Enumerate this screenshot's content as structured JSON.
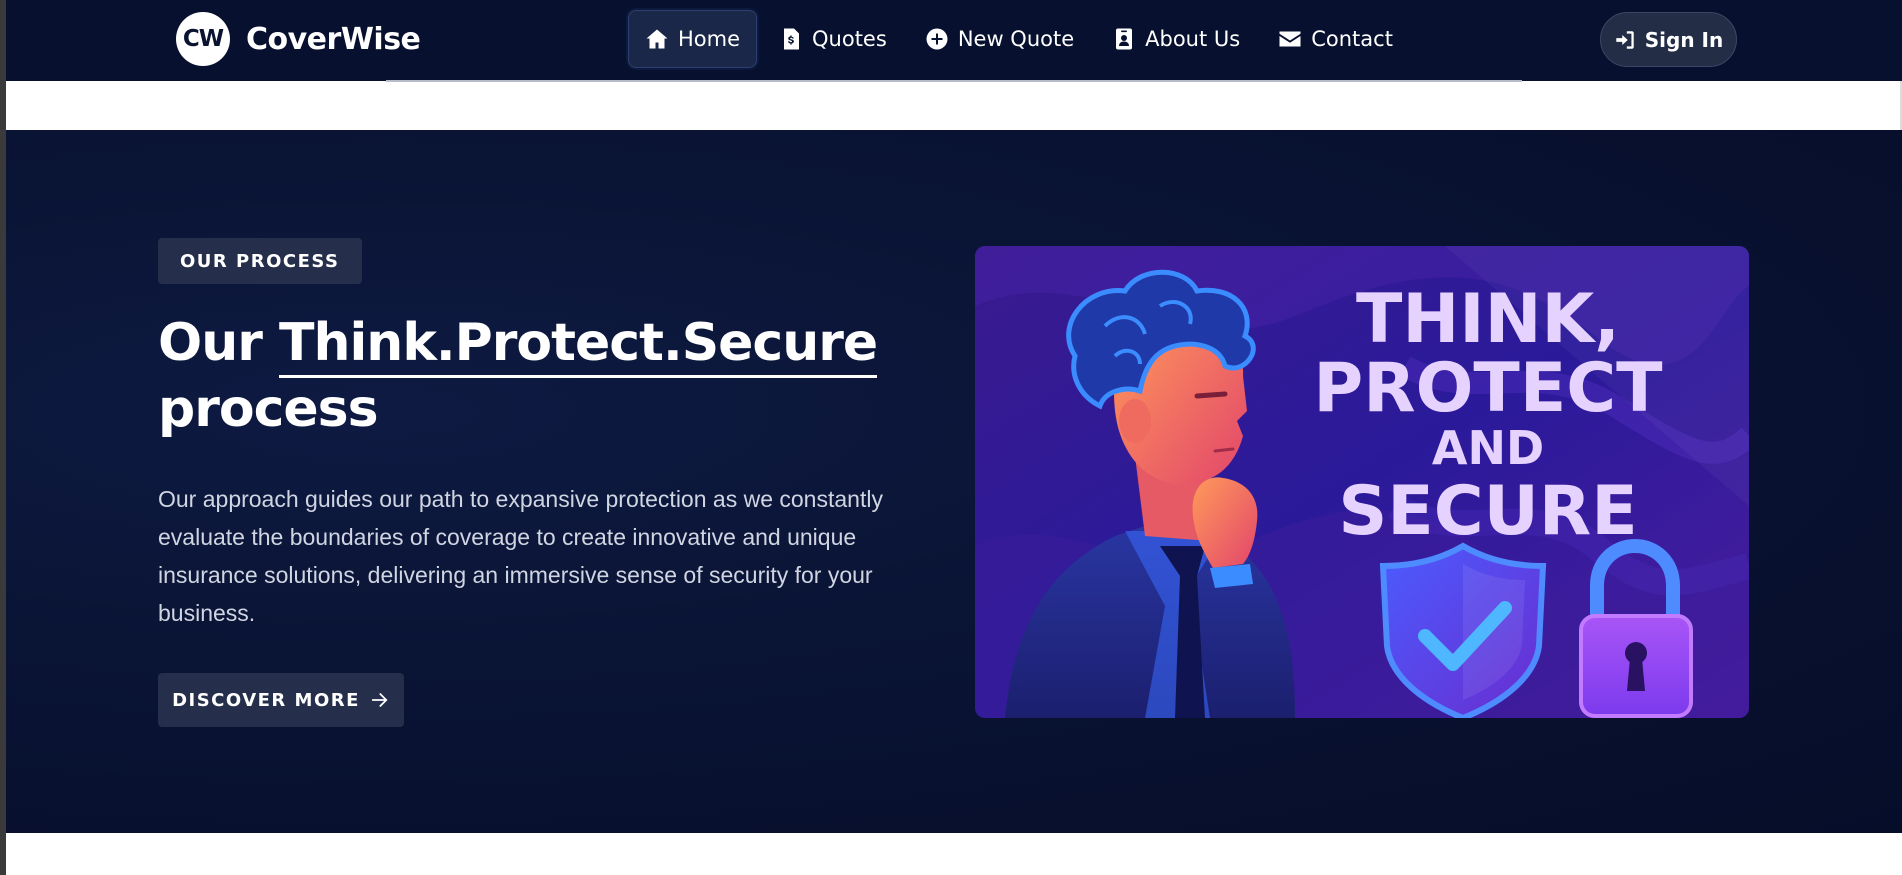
{
  "brand": {
    "logo_text": "CW",
    "name": "CoverWise"
  },
  "nav": {
    "items": [
      {
        "label": "Home",
        "icon": "home-icon",
        "active": true
      },
      {
        "label": "Quotes",
        "icon": "file-invoice-dollar-icon",
        "active": false
      },
      {
        "label": "New Quote",
        "icon": "plus-circle-icon",
        "active": false
      },
      {
        "label": "About Us",
        "icon": "id-badge-icon",
        "active": false
      },
      {
        "label": "Contact",
        "icon": "envelope-icon",
        "active": false
      }
    ],
    "signin_label": "Sign In"
  },
  "hero": {
    "eyebrow": "OUR PROCESS",
    "headline_prefix": "Our ",
    "headline_underlined": "Think.Protect.Secure",
    "headline_suffix": "process",
    "description": "Our approach guides our path to expansive protection as we constantly evaluate the boundaries of coverage to create innovative and unique insurance solutions, delivering an immersive sense of security for your business.",
    "cta_label": "DISCOVER MORE"
  },
  "illustration": {
    "line1": "THINK,",
    "line2": "PROTECT",
    "line3": "AND",
    "line4": "SECURE"
  },
  "colors": {
    "navbar_bg": "#07102e",
    "hero_bg": "#0a1435",
    "chip_bg": "#252f4b",
    "art_text": "#e6d2ff"
  }
}
